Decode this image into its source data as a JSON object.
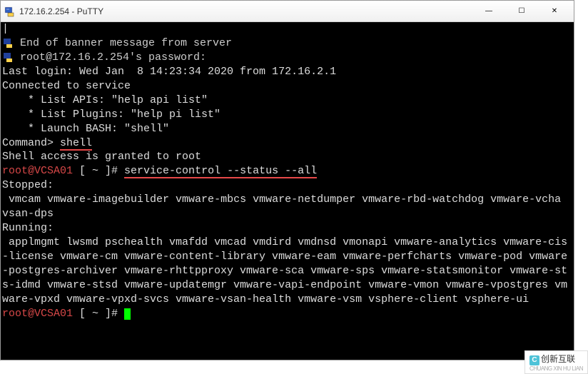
{
  "window": {
    "title": "172.16.2.254 - PuTTY",
    "controls": {
      "minimize": "—",
      "maximize": "☐",
      "close": "✕"
    }
  },
  "terminal": {
    "cursor_top": "|",
    "banner_line": " End of banner message from server",
    "password_prompt_user": " root@172.16.2.254",
    "password_prompt_suffix": "'s password:",
    "last_login": "Last login: Wed Jan  8 14:23:34 2020 from 172.16.2.1",
    "connected": "Connected to service",
    "blank": "",
    "list_apis": "    * List APIs: \"help api list\"",
    "list_plugins": "    * List Plugins: \"help pi list\"",
    "launch_bash": "    * Launch BASH: \"shell\"",
    "command_prompt": "Command> ",
    "shell_cmd": "shell",
    "shell_access": "Shell access is granted to root",
    "root_prompt_user": "root@VCSA01",
    "root_prompt_path": " [ ~ ]# ",
    "service_cmd": "service-control --status --all",
    "stopped_label": "Stopped:",
    "stopped_services": " vmcam vmware-imagebuilder vmware-mbcs vmware-netdumper vmware-rbd-watchdog vmware-vcha vsan-dps",
    "running_label": "Running:",
    "running_services": " applmgmt lwsmd pschealth vmafdd vmcad vmdird vmdnsd vmonapi vmware-analytics vmware-cis-license vmware-cm vmware-content-library vmware-eam vmware-perfcharts vmware-pod vmware-postgres-archiver vmware-rhttpproxy vmware-sca vmware-sps vmware-statsmonitor vmware-sts-idmd vmware-stsd vmware-updatemgr vmware-vapi-endpoint vmware-vmon vmware-vpostgres vmware-vpxd vmware-vpxd-svcs vmware-vsan-health vmware-vsm vsphere-client vsphere-ui"
  },
  "watermark": {
    "logo": "C",
    "text": "创新互联",
    "sub": "CHUANG XIN HU LIAN"
  }
}
